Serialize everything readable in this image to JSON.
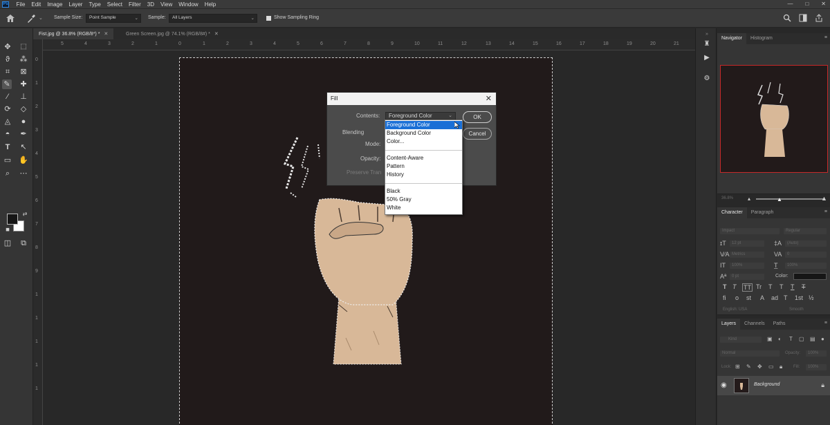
{
  "app": {
    "logo": "Ps"
  },
  "menu": [
    "File",
    "Edit",
    "Image",
    "Layer",
    "Type",
    "Select",
    "Filter",
    "3D",
    "View",
    "Window",
    "Help"
  ],
  "window_controls": [
    "—",
    "□",
    "✕"
  ],
  "options": {
    "sample_size_label": "Sample Size:",
    "sample_size_value": "Point Sample",
    "sample_label": "Sample:",
    "sample_value": "All Layers",
    "show_ring_label": "Show Sampling Ring"
  },
  "tabs": [
    {
      "label": "Fist.jpg @ 36.8% (RGB/8*) *",
      "close": "✕"
    },
    {
      "label": "Green Screen.jpg @ 74.1% (RGB/8#) *",
      "close": "✕"
    }
  ],
  "ruler_h": [
    "5",
    "4",
    "3",
    "2",
    "1",
    "0",
    "1",
    "2",
    "3",
    "4",
    "5",
    "6",
    "7",
    "8",
    "9",
    "10",
    "11",
    "12",
    "13",
    "14",
    "15",
    "16",
    "17",
    "18",
    "19",
    "20",
    "21"
  ],
  "ruler_v": [
    "0",
    "1",
    "2",
    "3",
    "4",
    "5",
    "6",
    "7",
    "8",
    "9",
    "1",
    "1",
    "1",
    "1",
    "1"
  ],
  "fill_dialog": {
    "title": "Fill",
    "close": "✕",
    "contents_label": "Contents:",
    "contents_value": "Foreground Color",
    "blending_label": "Blending",
    "mode_label": "Mode:",
    "opacity_label": "Opacity:",
    "preserve_label": "Preserve Tran",
    "ok_label": "OK",
    "cancel_label": "Cancel"
  },
  "dropdown": {
    "items": [
      "Foreground Color",
      "Background Color",
      "Color...",
      "Content-Aware",
      "Pattern",
      "History",
      "Black",
      "50% Gray",
      "White"
    ],
    "selected": "Foreground Color"
  },
  "navigator": {
    "tabs": [
      "Navigator",
      "Histogram"
    ],
    "zoom": "36.8%"
  },
  "character": {
    "tabs": [
      "Character",
      "Paragraph"
    ],
    "font": "Impact",
    "style": "Regular",
    "size": "12 pt",
    "leading": "(Auto)",
    "tracking": "Metrics",
    "kerning": "0",
    "vscale": "100%",
    "hscale": "100%",
    "baseline": "0 pt",
    "color_label": "Color:",
    "language": "English: USA",
    "aa": "Smooth",
    "style_buttons": [
      "T",
      "T",
      "TT",
      "Tr",
      "T",
      "T",
      "T",
      "T"
    ],
    "ot_buttons": [
      "fi",
      "o",
      "st",
      "A",
      "ad",
      "T",
      "1st",
      "½"
    ]
  },
  "layers": {
    "tabs": [
      "Layers",
      "Channels",
      "Paths"
    ],
    "kind_label": "Kind",
    "blend_mode": "Normal",
    "opacity_label": "Opacity:",
    "opacity_value": "100%",
    "lock_label": "Lock:",
    "fill_label": "Fill:",
    "fill_value": "100%",
    "layer_name": "Background"
  },
  "colors": {
    "foreground": "#161616",
    "background": "#ffffff",
    "selection_blue": "#1a6fd6",
    "canvas_bg": "#211a1a",
    "skin": "#d8b898"
  }
}
